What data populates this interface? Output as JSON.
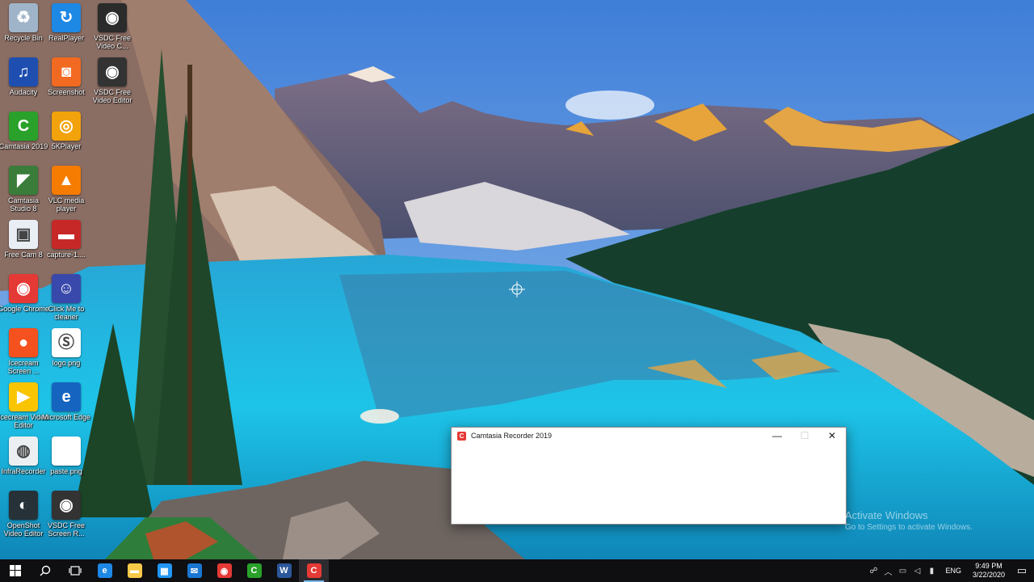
{
  "desktop_icons": [
    {
      "label": "Recycle Bin",
      "icon": "recycle-bin-icon",
      "color": "#9fb4c8",
      "glyph": "♻"
    },
    {
      "label": "RealPlayer",
      "icon": "realplayer-icon",
      "color": "#1e88e5",
      "glyph": "↻"
    },
    {
      "label": "VSDC Free Video C...",
      "icon": "vsdc-converter-icon",
      "color": "#2b2b2b",
      "glyph": "◉"
    },
    {
      "label": "Audacity",
      "icon": "audacity-icon",
      "color": "#1e4fb0",
      "glyph": "♫"
    },
    {
      "label": "Screenshot",
      "icon": "screenshot-icon",
      "color": "#f26a21",
      "glyph": "◙"
    },
    {
      "label": "VSDC Free Video Editor",
      "icon": "vsdc-editor-icon",
      "color": "#333333",
      "glyph": "◉"
    },
    {
      "label": "Camtasia 2019",
      "icon": "camtasia-icon",
      "color": "#2aa12a",
      "glyph": "C"
    },
    {
      "label": "5KPlayer",
      "icon": "5kplayer-icon",
      "color": "#f2a20a",
      "glyph": "◎"
    },
    {
      "label": "Camtasia Studio 8",
      "icon": "camtasia-studio-icon",
      "color": "#3a7d3a",
      "glyph": "◤"
    },
    {
      "label": "VLC media player",
      "icon": "vlc-icon",
      "color": "#f57c00",
      "glyph": "▲"
    },
    {
      "label": "Free Cam 8",
      "icon": "free-cam-icon",
      "color": "#e8eef4",
      "glyph": "▣"
    },
    {
      "label": "capture-1....",
      "icon": "video-file-icon",
      "color": "#c62828",
      "glyph": "▬"
    },
    {
      "label": "Google Chrome",
      "icon": "chrome-icon",
      "color": "#e53935",
      "glyph": "◉"
    },
    {
      "label": "Click Me to cleaner",
      "icon": "cleaner-icon",
      "color": "#3949ab",
      "glyph": "☺"
    },
    {
      "label": "Icecream Screen ...",
      "icon": "icecream-screen-icon",
      "color": "#f4511e",
      "glyph": "●"
    },
    {
      "label": "logo.png",
      "icon": "image-file-icon",
      "color": "#ffffff",
      "glyph": "Ⓢ"
    },
    {
      "label": "Icecream Video Editor",
      "icon": "icecream-video-icon",
      "color": "#f9c400",
      "glyph": "▶"
    },
    {
      "label": "Microsoft Edge",
      "icon": "edge-icon",
      "color": "#1565c0",
      "glyph": "e"
    },
    {
      "label": "InfraRecorder",
      "icon": "infrarecorder-icon",
      "color": "#eceff1",
      "glyph": "◍"
    },
    {
      "label": "paste.png",
      "icon": "image-file-icon",
      "color": "#ffffff",
      "glyph": ""
    },
    {
      "label": "OpenShot Video Editor",
      "icon": "openshot-icon",
      "color": "#263238",
      "glyph": "◐"
    },
    {
      "label": "VSDC Free Screen R...",
      "icon": "vsdc-recorder-icon",
      "color": "#333333",
      "glyph": "◉"
    }
  ],
  "recorder": {
    "title": "Camtasia Recorder 2019",
    "minimize": "—",
    "maximize": "☐",
    "close": "✕"
  },
  "watermark": {
    "line1": "Activate Windows",
    "line2": "Go to Settings to activate Windows."
  },
  "taskbar": {
    "apps": [
      {
        "name": "edge",
        "icon": "edge-icon",
        "glyph": "e",
        "color": "#1e88e5"
      },
      {
        "name": "file-explorer",
        "icon": "folder-icon",
        "glyph": "▬",
        "color": "#f7c948"
      },
      {
        "name": "store",
        "icon": "store-icon",
        "glyph": "▦",
        "color": "#2196f3"
      },
      {
        "name": "mail",
        "icon": "mail-icon",
        "glyph": "✉",
        "color": "#1976d2"
      },
      {
        "name": "chrome",
        "icon": "chrome-icon",
        "glyph": "◉",
        "color": "#e53935"
      },
      {
        "name": "camtasia",
        "icon": "camtasia-icon",
        "glyph": "C",
        "color": "#2aa12a"
      },
      {
        "name": "word",
        "icon": "word-icon",
        "glyph": "W",
        "color": "#2b579a"
      },
      {
        "name": "camtasia-recorder",
        "icon": "camtasia-recorder-icon",
        "glyph": "C",
        "color": "#e53935"
      }
    ],
    "language": "ENG",
    "time": "9:49 PM",
    "date": "3/22/2020"
  }
}
